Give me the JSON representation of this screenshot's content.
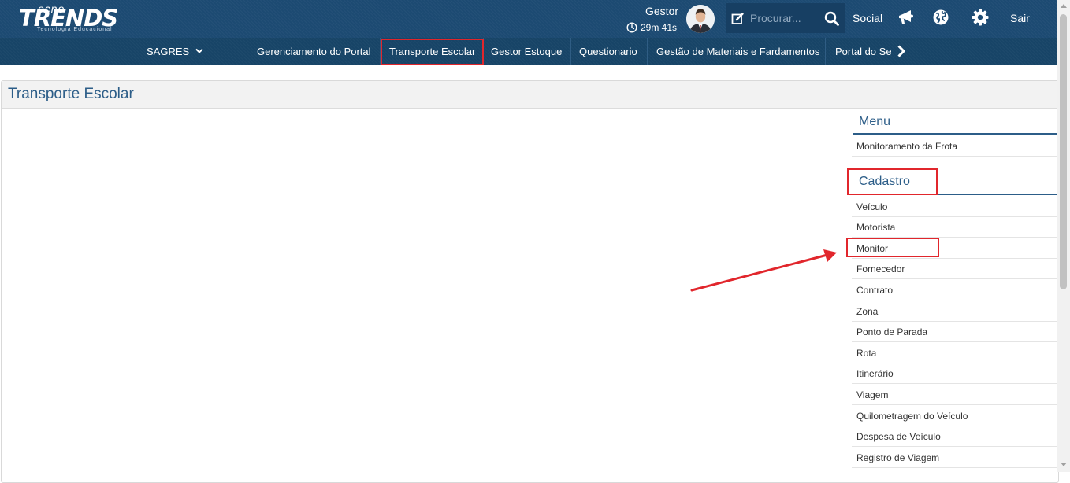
{
  "header": {
    "logo": {
      "top": "ecno",
      "main": "TRENDS",
      "sub": "Tecnologia Educacional"
    },
    "user": {
      "name": "Gestor",
      "timer": "29m 41s"
    },
    "search": {
      "placeholder": "Procurar..."
    },
    "social_label": "Social",
    "logout_label": "Sair"
  },
  "nav": {
    "sagres_label": "SAGRES",
    "items": [
      {
        "label": "Gerenciamento do Portal"
      },
      {
        "label": "Transporte Escolar"
      },
      {
        "label": "Gestor Estoque"
      },
      {
        "label": "Questionario"
      },
      {
        "label": "Gestão de Materiais e Fardamentos"
      },
      {
        "label": "Portal do Se"
      }
    ],
    "active_index": 1
  },
  "page": {
    "title": "Transporte Escolar"
  },
  "side_menu": {
    "menu_title": "Menu",
    "menu_items": [
      {
        "label": "Monitoramento da Frota"
      }
    ],
    "cadastro_title": "Cadastro",
    "cadastro_items": [
      {
        "label": "Veículo"
      },
      {
        "label": "Motorista"
      },
      {
        "label": "Monitor"
      },
      {
        "label": "Fornecedor"
      },
      {
        "label": "Contrato"
      },
      {
        "label": "Zona"
      },
      {
        "label": "Ponto de Parada"
      },
      {
        "label": "Rota"
      },
      {
        "label": "Itinerário"
      },
      {
        "label": "Viagem"
      },
      {
        "label": "Quilometragem do Veículo"
      },
      {
        "label": "Despesa de Veículo"
      },
      {
        "label": "Registro de Viagem"
      }
    ]
  },
  "colors": {
    "header_bg": "#1c4a72",
    "nav_bg": "#174467",
    "highlight": "#e1262c",
    "title_blue": "#2c5d88"
  },
  "icons": [
    "clock-icon",
    "avatar",
    "edit-icon",
    "search-icon",
    "megaphone-icon",
    "globe-icon",
    "gear-icon",
    "chevron-down-icon",
    "chevron-right-icon"
  ]
}
